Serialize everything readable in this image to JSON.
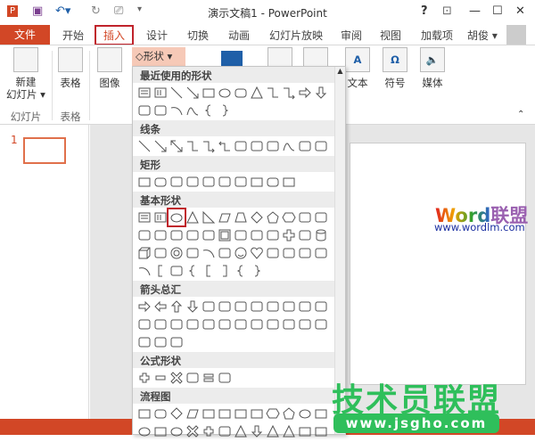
{
  "titlebar": {
    "title": "演示文稿1 - PowerPoint",
    "help": "?",
    "minimize": "—",
    "maximize": "☐",
    "close": "✕"
  },
  "tabs": {
    "file": "文件",
    "items": [
      "开始",
      "插入",
      "设计",
      "切换",
      "动画",
      "幻灯片放映",
      "审阅",
      "视图",
      "加载项"
    ],
    "active": "插入",
    "user": "胡俊 ▾"
  },
  "ribbon": {
    "new_slide": "新建\n幻灯片 ▾",
    "table": "表格",
    "images": "图像",
    "shapes_button": "形状 ▾",
    "text": "文本",
    "symbols": "符号",
    "media": "媒体",
    "group_slides": "幻灯片",
    "group_tables": "表格"
  },
  "shapes_panel": {
    "sections": [
      {
        "title": "最近使用的形状",
        "rows": [
          [
            "textbox",
            "vtextbox",
            "line",
            "arrowline",
            "rect",
            "ellipse",
            "roundrect",
            "triangle",
            "elbow",
            "elbowarrow",
            "rightarrow",
            "downarrow"
          ],
          [
            "freeform",
            "scribble",
            "arc",
            "curve",
            "lbrace",
            "rbrace"
          ]
        ]
      },
      {
        "title": "线条",
        "rows": [
          [
            "line",
            "arrowline",
            "dblarrow",
            "elbow",
            "elbowarrow",
            "elbowdbl",
            "curvedconn",
            "curvedconnarrow",
            "curveddbl",
            "curve",
            "freeform",
            "scribble"
          ]
        ]
      },
      {
        "title": "矩形",
        "rows": [
          [
            "rect",
            "roundrect",
            "snip1",
            "snip2",
            "snipround",
            "round1",
            "round2",
            "rect",
            "roundrect",
            "rect"
          ]
        ]
      },
      {
        "title": "基本形状",
        "rows": [
          [
            "textbox",
            "vtextbox",
            "ellipse",
            "triangle",
            "rtriangle",
            "parallelogram",
            "trapezoid",
            "diamond",
            "pentagon",
            "hexagon",
            "heptagon",
            "octagon"
          ],
          [
            "decagon",
            "dodecagon",
            "pie",
            "chord",
            "teardrop",
            "frame",
            "halfframe",
            "lshape",
            "diagstripe",
            "cross",
            "plaque",
            "can"
          ],
          [
            "cube",
            "bevel",
            "donut",
            "nosmoking",
            "arc",
            "foldedcorner",
            "smiley",
            "heart",
            "lightning",
            "sun",
            "moon",
            "cloud"
          ],
          [
            "arc",
            "lbracket",
            "bracepair",
            "lbrace",
            "lbracket",
            "rbracket",
            "lbrace",
            "rbrace"
          ]
        ]
      },
      {
        "title": "箭头总汇",
        "rows": [
          [
            "rightarrow",
            "leftarrow",
            "uparrow",
            "downarrow",
            "lrarrow",
            "udarrow",
            "quadarrow",
            "luarrow",
            "bentarrow",
            "uturn",
            "leftuparrow",
            "bentup"
          ],
          [
            "curvedright",
            "curvedleft",
            "curvedup",
            "curveddown",
            "stripedright",
            "notched",
            "homeplate",
            "chevron",
            "rightcallout",
            "downcallout",
            "leftcallout",
            "upcallout"
          ],
          [
            "lrcallout",
            "quadcallout",
            "circular"
          ]
        ]
      },
      {
        "title": "公式形状",
        "rows": [
          [
            "plus",
            "minus",
            "multiply",
            "divide",
            "equal",
            "notequal"
          ]
        ]
      },
      {
        "title": "流程图",
        "rows": [
          [
            "rect",
            "roundrect",
            "diamond",
            "parallelogram",
            "rect",
            "rect",
            "rect",
            "rect",
            "hexagon",
            "pentagon",
            "ellipse",
            "rect"
          ],
          [
            "ellipse",
            "rect",
            "ellipse",
            "multiply",
            "plus",
            "bevel",
            "triangle",
            "downarrow",
            "triangle",
            "triangle",
            "rect",
            "rect"
          ]
        ]
      }
    ],
    "selected": "ellipse"
  },
  "slides": {
    "number": "1"
  },
  "watermarks": {
    "word": "Word",
    "word_cn": "联盟",
    "wordlm_url": "www.wordlm.com",
    "jsgho_cn": "技术员联盟",
    "jsgho_url": "www.jsgho.com"
  },
  "colors": {
    "accent": "#d24726",
    "selection": "#c0232b",
    "watermark_green": "#2fbf5b"
  }
}
